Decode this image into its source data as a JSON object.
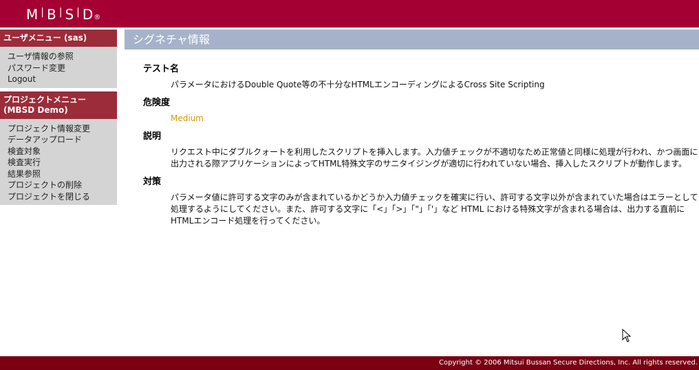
{
  "brand": {
    "letters": [
      "M",
      "B",
      "S",
      "D"
    ],
    "colors": {
      "header": "#a50034",
      "footer": "#7a0012",
      "menu_head": "#9c2c3a",
      "title_bar": "#a6b2c9",
      "medium": "#d49a00"
    }
  },
  "sidebar": {
    "user_menu": {
      "title": "ユーザメニュー (sas)",
      "items": [
        {
          "label": "ユーザ情報の参照"
        },
        {
          "label": "パスワード変更"
        },
        {
          "label": "Logout"
        }
      ]
    },
    "project_menu": {
      "title_line1": "プロジェクトメニュー",
      "title_line2": "(MBSD Demo)",
      "items": [
        {
          "label": "プロジェクト情報変更"
        },
        {
          "label": "データアップロード"
        },
        {
          "label": "検査対象"
        },
        {
          "label": "検査実行"
        },
        {
          "label": "結果参照"
        },
        {
          "label": "プロジェクトの削除"
        },
        {
          "label": "プロジェクトを閉じる"
        }
      ]
    }
  },
  "main": {
    "title": "シグネチャ情報",
    "sections": [
      {
        "title": "テスト名",
        "body": "パラメータにおけるDouble Quote等の不十分なHTMLエンコーディングによるCross Site Scripting"
      },
      {
        "title": "危険度",
        "body": "Medium"
      },
      {
        "title": "説明",
        "body": "リクエスト中にダブルクォートを利用したスクリプトを挿入します。入力値チェックが不適切なため正常値と同様に処理が行われ、かつ画面に出力される際アプリケーションによってHTML特殊文字のサニタイジングが適切に行われていない場合、挿入したスクリプトが動作します。"
      },
      {
        "title": "対策",
        "body": "パラメータ値に許可する文字のみが含まれているかどうか入力値チェックを確実に行い、許可する文字以外が含まれていた場合はエラーとして処理するようにしてください。また、許可する文字に「<」「>」「\"」「'」など HTML における特殊文字が含まれる場合は、出力する直前にHTMLエンコード処理を行ってください。"
      }
    ]
  },
  "footer": {
    "copyright": "Copyright © 2006 Mitsui Bussan Secure Directions, Inc. All rights reserved."
  }
}
